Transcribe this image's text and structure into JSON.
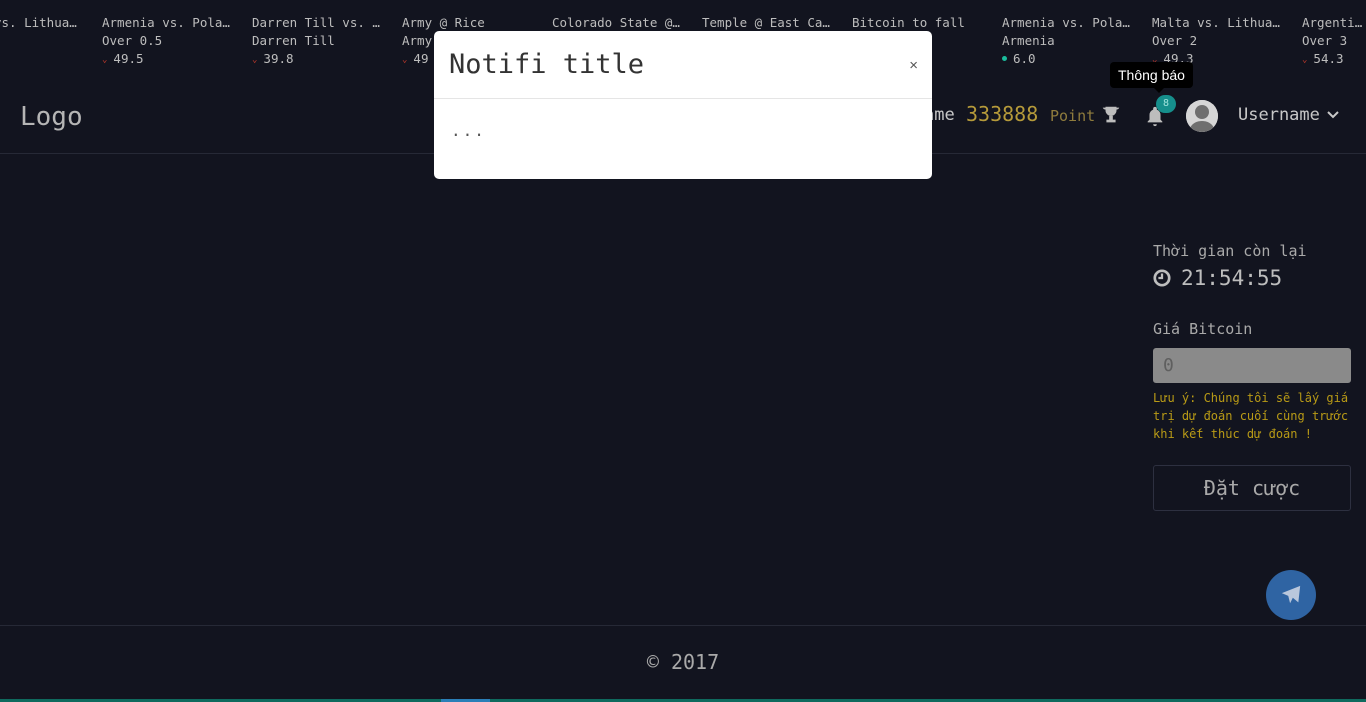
{
  "ticker": [
    {
      "title": "vs. Lithua…",
      "sub": "",
      "value": "",
      "trend": "none"
    },
    {
      "title": "Armenia vs. Pola…",
      "sub": "Over 0.5",
      "value": "49.5",
      "trend": "down"
    },
    {
      "title": "Darren Till vs. …",
      "sub": "Darren Till",
      "value": "39.8",
      "trend": "down"
    },
    {
      "title": "Army @ Rice",
      "sub": "Army",
      "value": "49",
      "trend": "down"
    },
    {
      "title": "Colorado State @…",
      "sub": "",
      "value": "",
      "trend": "none"
    },
    {
      "title": "Temple @ East Ca…",
      "sub": "",
      "value": "",
      "trend": "none"
    },
    {
      "title": "Bitcoin to fall",
      "sub": "",
      "value": "",
      "trend": "none"
    },
    {
      "title": "Armenia vs. Pola…",
      "sub": "Armenia",
      "value": "6.0",
      "trend": "up"
    },
    {
      "title": "Malta vs. Lithua…",
      "sub": "Over 2",
      "value": "49.3",
      "trend": "down"
    },
    {
      "title": "Argentina",
      "sub": "Over 3",
      "value": "54.3",
      "trend": "down"
    }
  ],
  "header": {
    "logo": "Logo",
    "username_prefix": "ame",
    "points": "333888",
    "points_label": "Point",
    "notif_count": "8",
    "username": "Username",
    "tooltip": "Thông báo"
  },
  "panel": {
    "time_label": "Thời gian còn lại",
    "countdown": "21:54:55",
    "price_label": "Giá Bitcoin",
    "price_placeholder": "0",
    "note": "Lưu ý: Chúng tôi sẽ lấy giá trị dự đoán cuối cùng trước khi kết thúc dự đoán !",
    "bet_button": "Đặt cược"
  },
  "footer": {
    "copyright": "© 2017"
  },
  "modal": {
    "title": "Notifi title",
    "close": "×",
    "body": "..."
  },
  "colors": {
    "background": "#12141f",
    "points": "#b59a3a",
    "note": "#b89a16",
    "badge": "#168f8c",
    "fab": "#2f64a3"
  }
}
